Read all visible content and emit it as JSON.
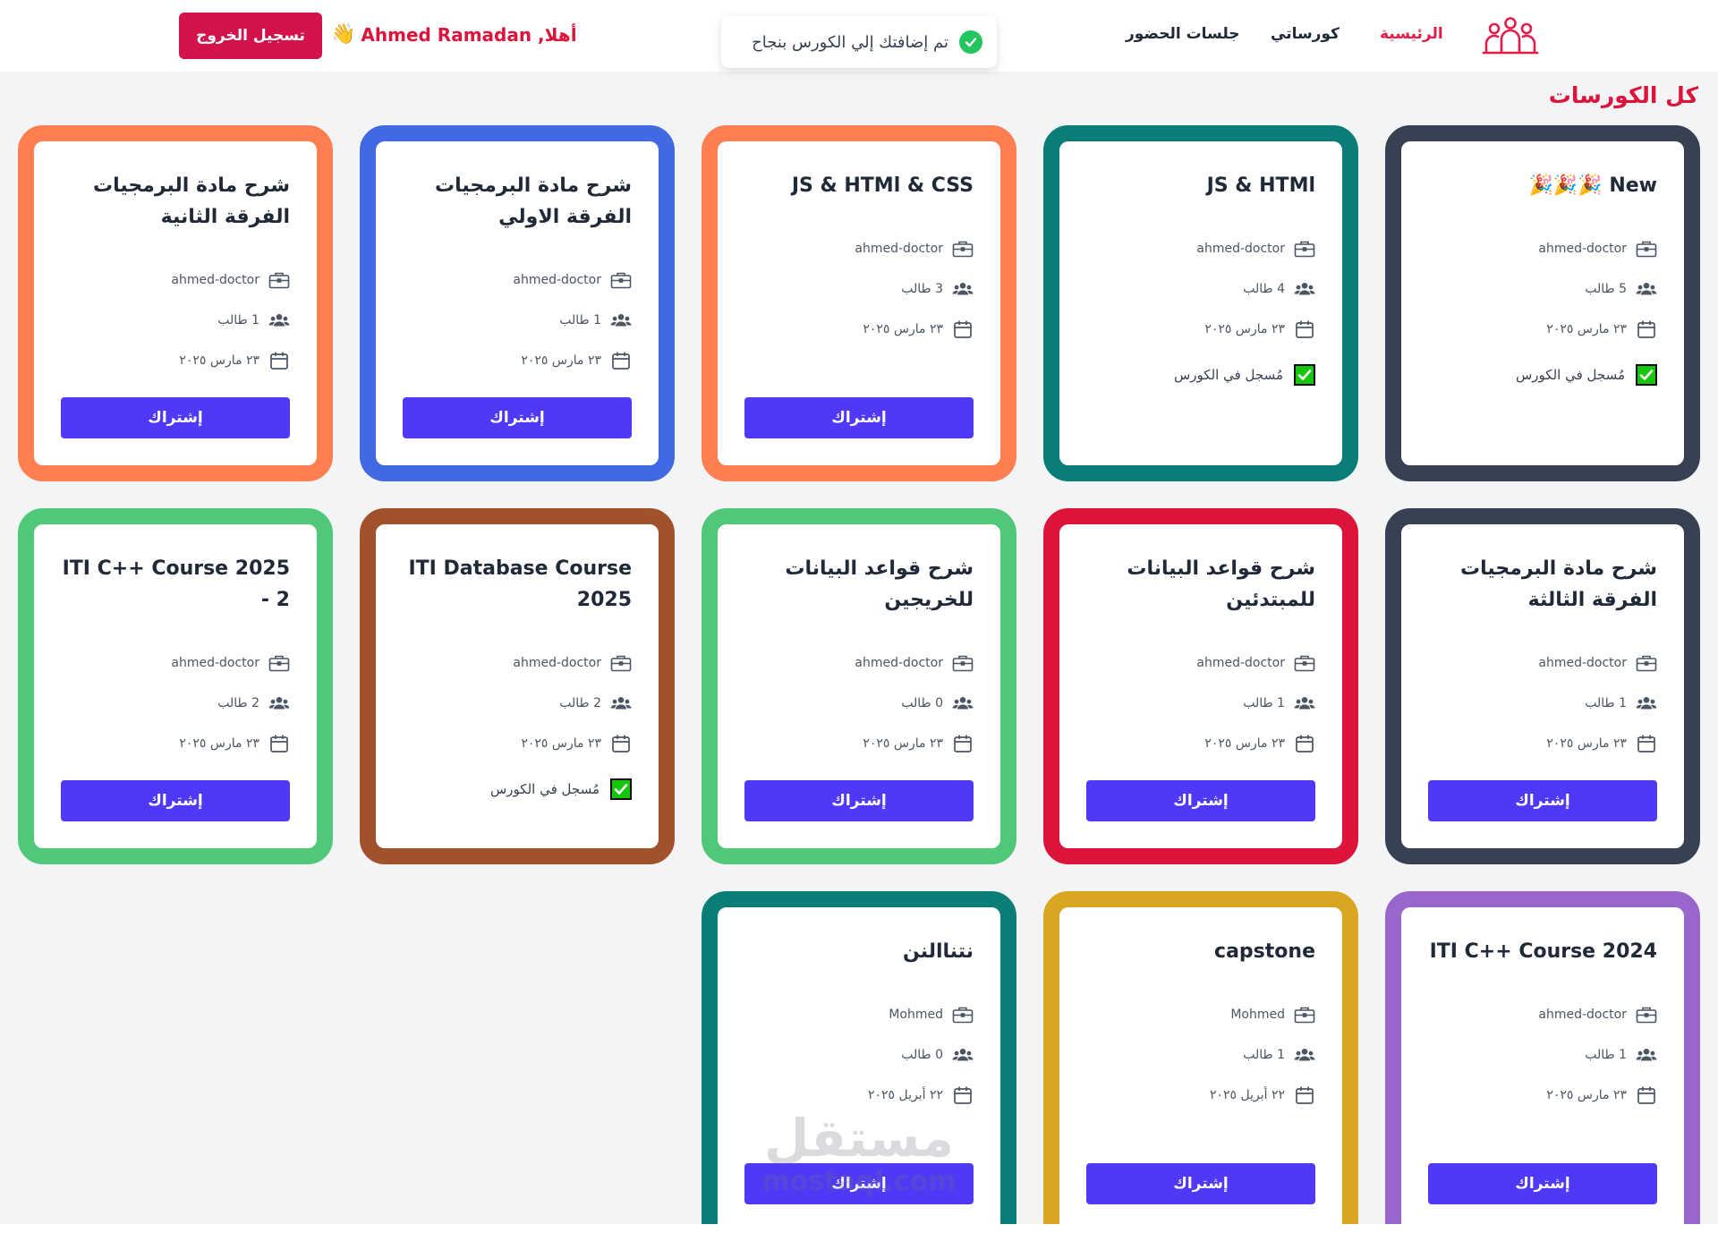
{
  "header": {
    "nav": {
      "home": "الرئيسية",
      "my_courses": "كورساتي",
      "attendance": "جلسات الحضور"
    },
    "toast": "تم إضافتك إلي الكورس بنجاح",
    "greeting": "أهلا, Ahmed Ramadan",
    "greeting_emoji": "👋",
    "logout": "تسجيل الخروج"
  },
  "page_title": "كل الكورسات",
  "courses": [
    {
      "title": "New 🎉🎉🎉",
      "instructor": "ahmed-doctor",
      "students": "5 طالب",
      "date": "٢٣ مارس ٢٠٢٥",
      "enrolled": true,
      "enrolled_label": "مُسجل في الكورس",
      "border": "#374151"
    },
    {
      "title": "JS & HTMl",
      "instructor": "ahmed-doctor",
      "students": "4 طالب",
      "date": "٢٣ مارس ٢٠٢٥",
      "enrolled": true,
      "enrolled_label": "مُسجل في الكورس",
      "border": "#0b7d77"
    },
    {
      "title": "JS & HTMl & CSS",
      "instructor": "ahmed-doctor",
      "students": "3 طالب",
      "date": "٢٣ مارس ٢٠٢٥",
      "enrolled": false,
      "button": "إشتراك",
      "border": "#ff7f50"
    },
    {
      "title": "شرح مادة البرمجيات الفرقة الاولي",
      "instructor": "ahmed-doctor",
      "students": "1 طالب",
      "date": "٢٣ مارس ٢٠٢٥",
      "enrolled": false,
      "button": "إشتراك",
      "border": "#4169e1"
    },
    {
      "title": "شرح مادة البرمجيات الفرقة الثانية",
      "instructor": "ahmed-doctor",
      "students": "1 طالب",
      "date": "٢٣ مارس ٢٠٢٥",
      "enrolled": false,
      "button": "إشتراك",
      "border": "#ff7f50"
    },
    {
      "title": "شرح مادة البرمجيات الفرقة الثالثة",
      "instructor": "ahmed-doctor",
      "students": "1 طالب",
      "date": "٢٣ مارس ٢٠٢٥",
      "enrolled": false,
      "button": "إشتراك",
      "border": "#374151"
    },
    {
      "title": "شرح قواعد البيانات للمبتدئين",
      "instructor": "ahmed-doctor",
      "students": "1 طالب",
      "date": "٢٣ مارس ٢٠٢٥",
      "enrolled": false,
      "button": "إشتراك",
      "border": "#dc143c"
    },
    {
      "title": "شرح قواعد البيانات للخريجين",
      "instructor": "ahmed-doctor",
      "students": "0 طالب",
      "date": "٢٣ مارس ٢٠٢٥",
      "enrolled": false,
      "button": "إشتراك",
      "border": "#50c878"
    },
    {
      "title": "ITI Database Course 2025",
      "instructor": "ahmed-doctor",
      "students": "2 طالب",
      "date": "٢٣ مارس ٢٠٢٥",
      "enrolled": true,
      "enrolled_label": "مُسجل في الكورس",
      "border": "#a0522d"
    },
    {
      "title": "ITI C++ Course 2025 - 2",
      "instructor": "ahmed-doctor",
      "students": "2 طالب",
      "date": "٢٣ مارس ٢٠٢٥",
      "enrolled": false,
      "button": "إشتراك",
      "border": "#50c878"
    },
    {
      "title": "ITI C++ Course 2024",
      "instructor": "ahmed-doctor",
      "students": "1 طالب",
      "date": "٢٣ مارس ٢٠٢٥",
      "enrolled": false,
      "button": "إشتراك",
      "border": "#9966cc"
    },
    {
      "title": "capstone",
      "instructor": "Mohmed",
      "students": "1 طالب",
      "date": "٢٢ أبريل ٢٠٢٥",
      "enrolled": false,
      "button": "إشتراك",
      "border": "#daa520"
    },
    {
      "title": "نتناالنن",
      "instructor": "Mohmed",
      "students": "0 طالب",
      "date": "٢٢ أبريل ٢٠٢٥",
      "enrolled": false,
      "button": "إشتراك",
      "border": "#0b7d77"
    }
  ],
  "watermark": {
    "ar": "مستقل",
    "en": "mostaql.com"
  }
}
